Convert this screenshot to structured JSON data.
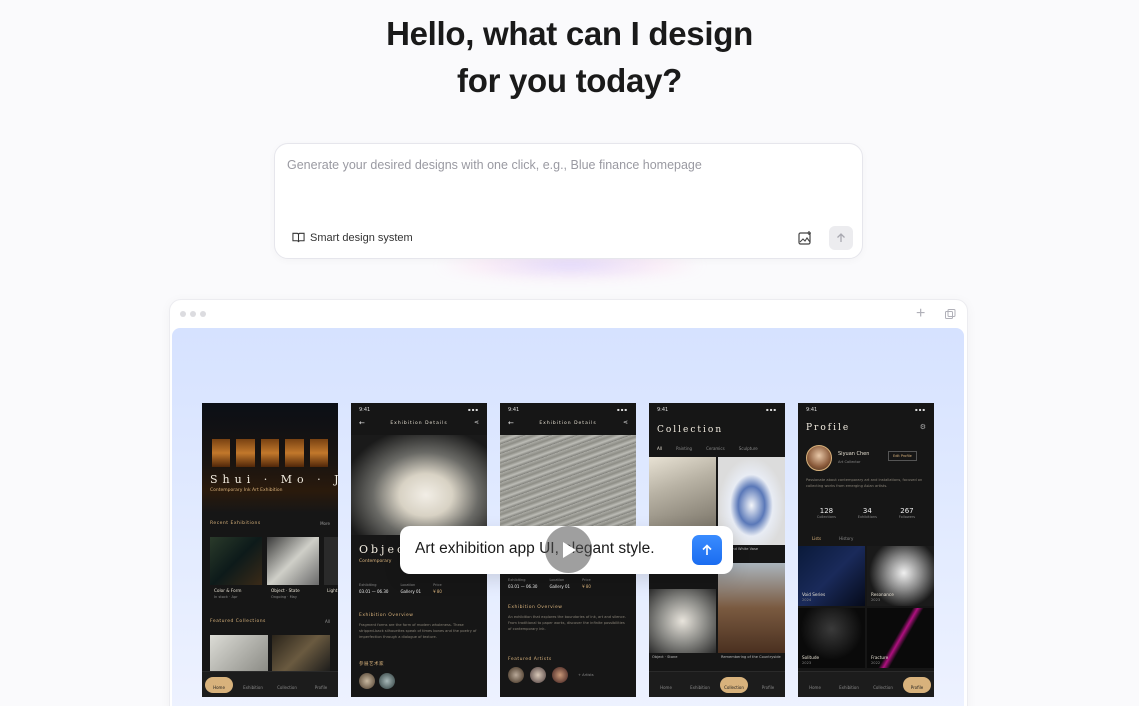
{
  "hero": {
    "line1": "Hello, what can I design",
    "line2": "for you today?"
  },
  "prompt": {
    "placeholder": "Generate your desired designs with one click, e.g., Blue finance homepage",
    "smart_design_label": "Smart design system",
    "upload_icon": "image-upload-icon",
    "send_icon": "arrow-up-icon"
  },
  "preview": {
    "window_controls": [
      "dot",
      "dot",
      "dot"
    ],
    "plus_icon": "plus-icon",
    "copy_icon": "copy-icon",
    "chat_text": "Art exhibition app UI, elegant style.",
    "play_icon": "play-icon",
    "accent_color": "#1a6cf0",
    "gold_color": "#d8b27c"
  },
  "phones": {
    "time": "9:41",
    "p1": {
      "title": "Shui · Mo · Ji",
      "subtitle": "Contemporary Ink Art Exhibition",
      "recent_label": "Recent Exhibitions",
      "recent_more": "More",
      "cards": [
        {
          "title": "Color & Form",
          "sub": "In stock · Apr"
        },
        {
          "title": "Object · State",
          "sub": "Ongoing · May"
        },
        {
          "title": "Light",
          "sub": ""
        }
      ],
      "featured_label": "Featured Collections",
      "featured_more": "All",
      "tabs": [
        "Home",
        "Exhibition",
        "Collection",
        "Profile"
      ]
    },
    "p2": {
      "header": "Exhibition Details",
      "title": "Objec",
      "subtitle": "Contemporary",
      "info": [
        {
          "k": "Exhibiting",
          "v": "03.01 — 06.30"
        },
        {
          "k": "Location",
          "v": "Gallery 01"
        },
        {
          "k": "Price",
          "v": "¥ 80"
        }
      ],
      "overview_label": "Exhibition Overview",
      "overview_text": "Fragment forms are the form of modern wholeness. These stripped-back silhouettes speak of times bones and the poetry of imperfection through a dialogue of texture.",
      "artists_label": "参展艺术家"
    },
    "p3": {
      "header": "Exhibition Details",
      "info": [
        {
          "k": "Exhibiting",
          "v": "03.01 — 06.30"
        },
        {
          "k": "Location",
          "v": "Gallery 01"
        },
        {
          "k": "Price",
          "v": "¥ 80"
        }
      ],
      "overview_label": "Exhibition Overview",
      "overview_text": "An exhibition that explores the boundaries of ink, art and silence. From traditional to paper works, discover the infinite possibilities of contemporary ink.",
      "artists_label": "Featured Artists",
      "artists_more": "+ Artists"
    },
    "p4": {
      "title": "Collection",
      "filters": [
        "All",
        "Painting",
        "Ceramics",
        "Sculpture"
      ],
      "items": [
        {
          "title": "",
          "sub": ""
        },
        {
          "title": "Blue and White Vase",
          "sub": ""
        },
        {
          "title": "Object · Stone",
          "sub": "2023"
        },
        {
          "title": "Remembering of the Countryside",
          "sub": ""
        }
      ],
      "tabs": [
        "Home",
        "Exhibition",
        "Collection",
        "Profile"
      ]
    },
    "p5": {
      "title": "Profile",
      "name": "Siyuan Chen",
      "role": "Art Collector",
      "edit_label": "Edit Profile",
      "bio": "Passionate about contemporary art and installations, focused on collecting works from emerging Asian artists.",
      "stats": [
        {
          "n": "128",
          "l": "Collections"
        },
        {
          "n": "34",
          "l": "Exhibitions"
        },
        {
          "n": "267",
          "l": "Followers"
        }
      ],
      "tabs_small": [
        "Lists",
        "History"
      ],
      "works": [
        {
          "t": "Void Series",
          "y": "2024"
        },
        {
          "t": "Resonance",
          "y": "2023"
        },
        {
          "t": "Solitude",
          "y": "2023"
        },
        {
          "t": "Fracture",
          "y": "2022"
        }
      ],
      "tabs": [
        "Home",
        "Exhibition",
        "Collection",
        "Profile"
      ]
    }
  }
}
